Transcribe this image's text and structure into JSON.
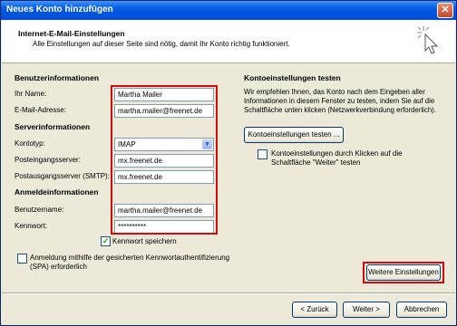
{
  "window": {
    "title": "Neues Konto hinzufügen",
    "close_glyph": "✕"
  },
  "header": {
    "title": "Internet-E-Mail-Einstellungen",
    "subtitle": "Alle Einstellungen auf dieser Seite sind nötig, damit Ihr Konto richtig funktioniert."
  },
  "left": {
    "user_info_heading": "Benutzerinformationen",
    "name_label": "Ihr Name:",
    "name_value": "Martha Mailer",
    "email_label": "E-Mail-Adresse:",
    "email_value": "martha.mailer@freenet.de",
    "server_info_heading": "Serverinformationen",
    "account_type_label": "Kontotyp:",
    "account_type_value": "IMAP",
    "incoming_label": "Posteingangsserver:",
    "incoming_value": "mx.freenet.de",
    "outgoing_label": "Postausgangsserver (SMTP):",
    "outgoing_value": "mx.freenet.de",
    "login_info_heading": "Anmeldeinformationen",
    "username_label": "Benutzername:",
    "username_value": "martha.mailer@freenet.de",
    "password_label": "Kennwort:",
    "password_value": "**********",
    "remember_password_label": "Kennwort speichern",
    "remember_password_checked": true,
    "spa_label_line1": "Anmeldung mithilfe der gesicherten Kennwortauthentifizierung",
    "spa_label_line2": "(SPA) erforderlich",
    "spa_checked": false
  },
  "right": {
    "test_heading": "Kontoeinstellungen testen",
    "test_text_line1": "Wir empfehlen Ihnen, das Konto nach dem Eingeben aller",
    "test_text_line2": "Informationen in diesem Fenster zu testen, indem Sie auf die",
    "test_text_line3": "Schaltfläche unten klicken (Netzwerkverbindung erforderlich).",
    "test_button_label": "Kontoeinstellungen testen ...",
    "test_on_next_line1": "Kontoeinstellungen durch Klicken auf die",
    "test_on_next_line2": "Schaltfläche \"Weiter\" testen",
    "test_on_next_checked": false,
    "more_settings_label": "Weitere Einstellungen"
  },
  "footer": {
    "back_label": "< Zurück",
    "next_label": "Weiter >",
    "cancel_label": "Abbrechen"
  },
  "colors": {
    "highlight_red": "#d40a0a",
    "title_blue": "#0054e3"
  }
}
